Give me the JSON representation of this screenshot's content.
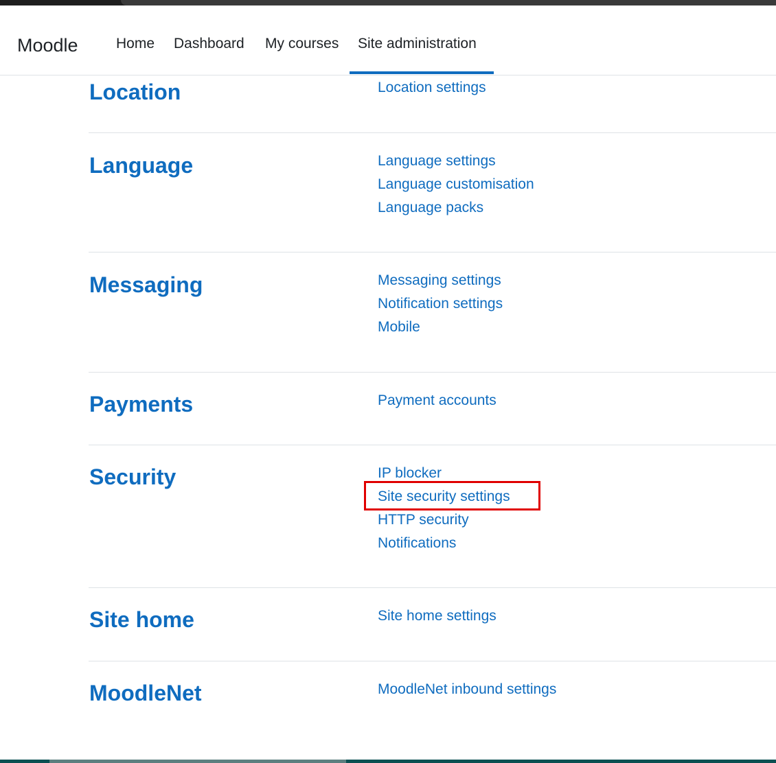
{
  "app": {
    "brand": "Moodle"
  },
  "nav": {
    "items": [
      {
        "label": "Home"
      },
      {
        "label": "Dashboard"
      },
      {
        "label": "My courses"
      },
      {
        "label": "Site administration",
        "active": true
      }
    ]
  },
  "sections": [
    {
      "title": "Location",
      "links": [
        "Location settings"
      ]
    },
    {
      "title": "Language",
      "links": [
        "Language settings",
        "Language customisation",
        "Language packs"
      ]
    },
    {
      "title": "Messaging",
      "links": [
        "Messaging settings",
        "Notification settings",
        "Mobile"
      ]
    },
    {
      "title": "Payments",
      "links": [
        "Payment accounts"
      ]
    },
    {
      "title": "Security",
      "links": [
        "IP blocker",
        "Site security settings",
        "HTTP security",
        "Notifications"
      ]
    },
    {
      "title": "Site home",
      "links": [
        "Site home settings"
      ]
    },
    {
      "title": "MoodleNet",
      "links": [
        "MoodleNet inbound settings"
      ]
    }
  ],
  "highlight": {
    "target": "Site security settings",
    "color": "#e00000"
  },
  "colors": {
    "accent": "#0f6cbf",
    "text": "#1d2125",
    "divider": "#dee2e6"
  }
}
